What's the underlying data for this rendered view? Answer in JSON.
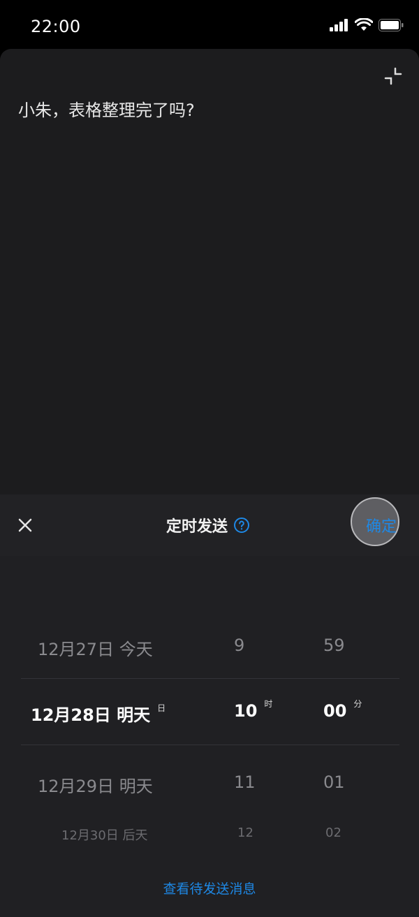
{
  "status_bar": {
    "time": "22:00",
    "icons": [
      "signal-icon",
      "wifi-icon",
      "battery-icon"
    ]
  },
  "compose": {
    "message": "小朱，表格整理完了吗?",
    "collapse_icon": "collapse-icon"
  },
  "picker": {
    "title": "定时发送",
    "help_icon": "help-icon",
    "close_icon": "close-icon",
    "confirm_label": "确定",
    "rows": {
      "prev": {
        "date": "12月27日 今天",
        "hour": "9",
        "minute": "59"
      },
      "selected": {
        "date": "12月28日 明天",
        "date_unit": "日",
        "hour": "10",
        "hour_unit": "时",
        "minute": "00",
        "minute_unit": "分"
      },
      "next": {
        "date": "12月29日 明天",
        "hour": "11",
        "minute": "01"
      },
      "next2": {
        "date": "12月30日 后天",
        "hour": "12",
        "minute": "02"
      }
    },
    "view_pending_label": "查看待发送消息"
  },
  "colors": {
    "accent": "#1e88e5",
    "sheet_bg": "#1c1c1e",
    "picker_bg": "#202023"
  }
}
